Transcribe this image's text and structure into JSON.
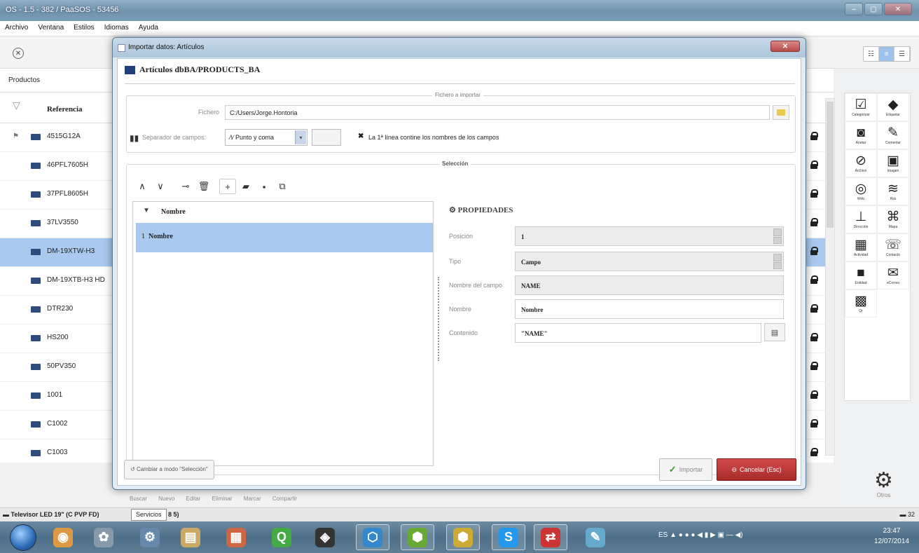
{
  "window": {
    "title": "OS - 1.5 - 382 / PaaSOS - 53456",
    "controls": [
      "–",
      "▢",
      "✕"
    ]
  },
  "menu": [
    "Archivo",
    "Ventana",
    "Estilos",
    "Idiomas",
    "Ayuda"
  ],
  "section": {
    "label": "Productos"
  },
  "table": {
    "column_header": "Referencia",
    "rows": [
      {
        "ref": "4515G12A",
        "selected": false
      },
      {
        "ref": "46PFL7605H",
        "selected": false
      },
      {
        "ref": "37PFL8605H",
        "selected": false
      },
      {
        "ref": "37LV3550",
        "selected": false
      },
      {
        "ref": "DM-19XTW-H3",
        "selected": true
      },
      {
        "ref": "DM-19XTB-H3 HD",
        "selected": false
      },
      {
        "ref": "DTR230",
        "selected": false
      },
      {
        "ref": "HS200",
        "selected": false
      },
      {
        "ref": "50PV350",
        "selected": false
      },
      {
        "ref": "1001",
        "selected": false
      },
      {
        "ref": "C1002",
        "selected": false
      },
      {
        "ref": "C1003",
        "selected": false
      }
    ]
  },
  "side_panel": {
    "items": [
      {
        "icon": "categorize-icon",
        "glyph": "☑",
        "label": "Categorizar"
      },
      {
        "icon": "tag-icon",
        "glyph": "◆",
        "label": "Etiquetar"
      },
      {
        "icon": "onenote-icon",
        "glyph": "◙",
        "label": "Anotar"
      },
      {
        "icon": "comment-icon",
        "glyph": "✎",
        "label": "Comentar"
      },
      {
        "icon": "attachment-icon",
        "glyph": "⊘",
        "label": "Archivo"
      },
      {
        "icon": "image-icon",
        "glyph": "▣",
        "label": "Imagen"
      },
      {
        "icon": "web-icon",
        "glyph": "◎",
        "label": "Web"
      },
      {
        "icon": "rss-icon",
        "glyph": "≋",
        "label": "Rss"
      },
      {
        "icon": "address-icon",
        "glyph": "⊥",
        "label": "Dirección"
      },
      {
        "icon": "map-icon",
        "glyph": "⌘",
        "label": "Mapa"
      },
      {
        "icon": "activities-icon",
        "glyph": "▦",
        "label": "Actividad"
      },
      {
        "icon": "contact-icon",
        "glyph": "☏",
        "label": "Contacto"
      },
      {
        "icon": "entities-icon",
        "glyph": "■",
        "label": "Entidad"
      },
      {
        "icon": "email-icon",
        "glyph": "✉",
        "label": "eCorreo"
      },
      {
        "icon": "qr-icon",
        "glyph": "▩",
        "label": "Qr"
      }
    ],
    "others_label": "Otros"
  },
  "bottom_actions": [
    "Buscar",
    "Nuevo",
    "Editar",
    "Eliminar",
    "Marcar",
    "Compartir"
  ],
  "status": {
    "text": "Televisor LED 19\" (C PVP FD)",
    "suffix": "8 5)",
    "tooltip": "Servicios",
    "count": "32"
  },
  "dialog": {
    "title": "Importar datos: Artículos",
    "header": "Artículos dbBA/PRODUCTS_BA",
    "file_section": {
      "legend": "Fichero a importar",
      "file_label": "Fichero",
      "file_path": "C:/Users/Jorge.Hontoria",
      "separator_label": "Separador de campos:",
      "separator_value": "Punto y coma",
      "first_line_checked": true,
      "first_line_label": "La 1ª línea contine los nombres de los campos"
    },
    "selection": {
      "legend": "Selección",
      "list_header": "Nombre",
      "items": [
        {
          "index": "1",
          "name": "Nombre"
        }
      ],
      "properties_title": "PROPIEDADES",
      "properties": [
        {
          "label": "Posición",
          "value": "1"
        },
        {
          "label": "Tipo",
          "value": "Campo"
        },
        {
          "label": "Nombre del campo",
          "value": "NAME"
        },
        {
          "label": "Nombre",
          "value": "Nombre"
        },
        {
          "label": "Contenido",
          "value": "\"NAME\""
        }
      ]
    },
    "footer": {
      "mode_button": "Cambiar a modo \"Selección\"",
      "import_button": "Importar",
      "cancel_button": "Cancelar (Esc)"
    }
  },
  "taskbar": {
    "apps": [
      "chrome",
      "paint",
      "settings",
      "files",
      "office",
      "qt",
      "unity",
      "app-blue",
      "app-green",
      "app-yellow",
      "skype",
      "remote",
      "pen"
    ],
    "tray_lang": "ES",
    "time": "23:47",
    "date": "12/07/2014"
  }
}
